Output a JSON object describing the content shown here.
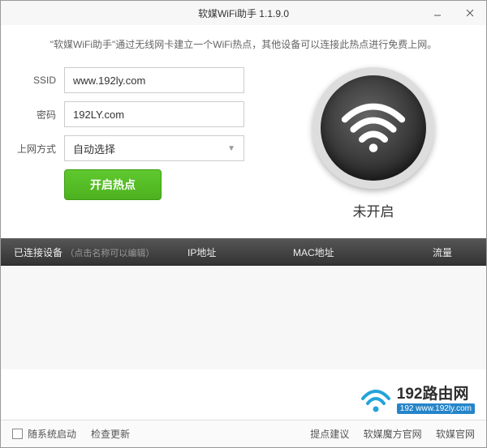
{
  "window": {
    "title": "软媒WiFi助手 1.1.9.0"
  },
  "description": "\"软媒WiFi助手\"通过无线网卡建立一个WiFi热点，其他设备可以连接此热点进行免费上网。",
  "form": {
    "ssid_label": "SSID",
    "ssid_value": "www.192ly.com",
    "password_label": "密码",
    "password_value": "192LY.com",
    "method_label": "上网方式",
    "method_value": "自动选择",
    "start_button": "开启热点"
  },
  "wifi": {
    "status": "未开启"
  },
  "table": {
    "col_device": "已连接设备",
    "col_device_hint": "（点击名称可以编辑）",
    "col_ip": "IP地址",
    "col_mac": "MAC地址",
    "col_traffic": "流量"
  },
  "watermark": {
    "title": "192路由网",
    "sub": "192 www.192ly.com"
  },
  "footer": {
    "autostart": "随系统启动",
    "check_update": "检查更新",
    "suggest": "提点建议",
    "ruanmei_official": "软媒魔方官网",
    "ruanmei_site": "软媒官网"
  }
}
